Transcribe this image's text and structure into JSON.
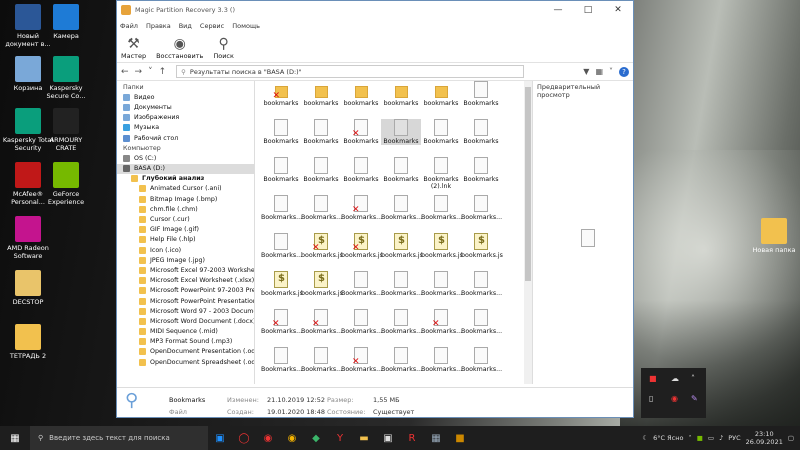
{
  "desktop_icons": [
    {
      "label": "Новый документ в...",
      "color": "#2b5797"
    },
    {
      "label": "Камера",
      "color": "#1e7bd6"
    },
    {
      "label": "Корзина",
      "color": "#7aa8d8"
    },
    {
      "label": "Kaspersky Secure Co...",
      "color": "#0a9e7c"
    },
    {
      "label": "Kaspersky Total Security",
      "color": "#0a9e7c"
    },
    {
      "label": "ARMOURY CRATE",
      "color": "#222"
    },
    {
      "label": "McAfee® Personal...",
      "color": "#c01818"
    },
    {
      "label": "GeForce Experience",
      "color": "#76b900"
    },
    {
      "label": "AMD Radeon Software",
      "color": "#c4148e"
    },
    {
      "label": "DECSTOP",
      "color": "#e9c46a"
    },
    {
      "label": "ТЕТРАДЬ 2",
      "color": "#f2c14e"
    },
    {
      "label": "Новая папка",
      "color": "#f2c14e"
    }
  ],
  "window": {
    "title": "Magic Partition Recovery 3.3 ()",
    "menu": [
      "Файл",
      "Правка",
      "Вид",
      "Сервис",
      "Помощь"
    ],
    "toolbar": {
      "master": "Мастер",
      "restore": "Восстановить",
      "search": "Поиск"
    },
    "address": "Результаты поиска в \"BASA (D:)\"",
    "preview_label": "Предварительный просмотр"
  },
  "tree": {
    "folders_header": "Папки",
    "folders": [
      "Видео",
      "Документы",
      "Изображения",
      "Музыка",
      "Рабочий стол"
    ],
    "computer_header": "Компьютер",
    "drives": [
      "OS (C:)",
      "BASA (D:)"
    ],
    "deep": "Глубокий анализ",
    "types": [
      "Animated Cursor (.ani)",
      "Bitmap Image (.bmp)",
      "chm.file (.chm)",
      "Cursor (.cur)",
      "GIF Image (.gif)",
      "Help File (.hlp)",
      "Icon (.ico)",
      "JPEG Image (.jpg)",
      "Microsoft Excel 97-2003 Worksheet",
      "Microsoft Excel Worksheet (.xlsx)",
      "Microsoft PowerPoint 97-2003 Pres",
      "Microsoft PowerPoint Presentation",
      "Microsoft Word 97 - 2003 Documen",
      "Microsoft Word Document (.docx)",
      "MIDI Sequence (.mid)",
      "MP3 Format Sound (.mp3)",
      "OpenDocument Presentation (.odp)",
      "OpenDocument Spreadsheet (.ods)"
    ]
  },
  "files": [
    [
      {
        "n": "bookmarks",
        "t": "fold",
        "x": true
      },
      {
        "n": "bookmarks",
        "t": "fold"
      },
      {
        "n": "bookmarks",
        "t": "fold"
      },
      {
        "n": "bookmarks",
        "t": "fold"
      },
      {
        "n": "bookmarks",
        "t": "fold"
      },
      {
        "n": "Bookmarks",
        "t": "doc"
      }
    ],
    [
      {
        "n": "Bookmarks",
        "t": "doc"
      },
      {
        "n": "Bookmarks",
        "t": "doc"
      },
      {
        "n": "Bookmarks",
        "t": "doc",
        "x": true
      },
      {
        "n": "Bookmarks",
        "t": "doc",
        "sel": true
      },
      {
        "n": "Bookmarks",
        "t": "doc"
      },
      {
        "n": "Bookmarks",
        "t": "doc"
      }
    ],
    [
      {
        "n": "Bookmarks",
        "t": "doc"
      },
      {
        "n": "Bookmarks",
        "t": "doc"
      },
      {
        "n": "Bookmarks",
        "t": "doc"
      },
      {
        "n": "Bookmarks",
        "t": "doc"
      },
      {
        "n": "Bookmarks (2).lnk",
        "t": "doc"
      },
      {
        "n": "Bookmarks",
        "t": "doc"
      }
    ],
    [
      {
        "n": "Bookmarks...",
        "t": "doc"
      },
      {
        "n": "Bookmarks...",
        "t": "doc"
      },
      {
        "n": "Bookmarks...",
        "t": "doc",
        "x": true
      },
      {
        "n": "Bookmarks...",
        "t": "doc"
      },
      {
        "n": "Bookmarks...",
        "t": "doc"
      },
      {
        "n": "Bookmarks...",
        "t": "doc"
      }
    ],
    [
      {
        "n": "Bookmarks...",
        "t": "doc"
      },
      {
        "n": "bookmarks.js",
        "t": "js",
        "x": true
      },
      {
        "n": "bookmarks.js",
        "t": "js",
        "x": true
      },
      {
        "n": "bookmarks.js",
        "t": "js"
      },
      {
        "n": "bookmarks.js",
        "t": "js"
      },
      {
        "n": "bookmarks.js",
        "t": "js"
      }
    ],
    [
      {
        "n": "bookmarks.js",
        "t": "js"
      },
      {
        "n": "bookmarks.js",
        "t": "js"
      },
      {
        "n": "Bookmarks...",
        "t": "doc"
      },
      {
        "n": "Bookmarks...",
        "t": "doc"
      },
      {
        "n": "Bookmarks...",
        "t": "doc"
      },
      {
        "n": "Bookmarks...",
        "t": "doc"
      }
    ],
    [
      {
        "n": "Bookmarks...",
        "t": "doc",
        "x": true
      },
      {
        "n": "Bookmarks...",
        "t": "doc",
        "x": true
      },
      {
        "n": "Bookmarks...",
        "t": "doc"
      },
      {
        "n": "Bookmarks...",
        "t": "doc"
      },
      {
        "n": "Bookmarks...",
        "t": "doc",
        "x": true
      },
      {
        "n": "Bookmarks...",
        "t": "doc"
      }
    ],
    [
      {
        "n": "Bookmarks...",
        "t": "doc"
      },
      {
        "n": "Bookmarks...",
        "t": "doc"
      },
      {
        "n": "Bookmarks...",
        "t": "doc",
        "x": true
      },
      {
        "n": "Bookmarks...",
        "t": "doc"
      },
      {
        "n": "Bookmarks...",
        "t": "doc"
      },
      {
        "n": "Bookmarks...",
        "t": "doc"
      }
    ]
  ],
  "status": {
    "name": "Bookmarks",
    "kind": "Файл",
    "modified_label": "Изменен:",
    "modified": "21.10.2019 12:52",
    "created_label": "Создан:",
    "created": "19.01.2020 18:48",
    "size_label": "Размер:",
    "size": "1,55 МБ",
    "state_label": "Состояние:",
    "state": "Существует"
  },
  "taskbar": {
    "search_placeholder": "Введите здесь текст для поиска",
    "weather": "6°C Ясно",
    "lang": "РУС",
    "time": "23:10",
    "date": "26.09.2021"
  }
}
